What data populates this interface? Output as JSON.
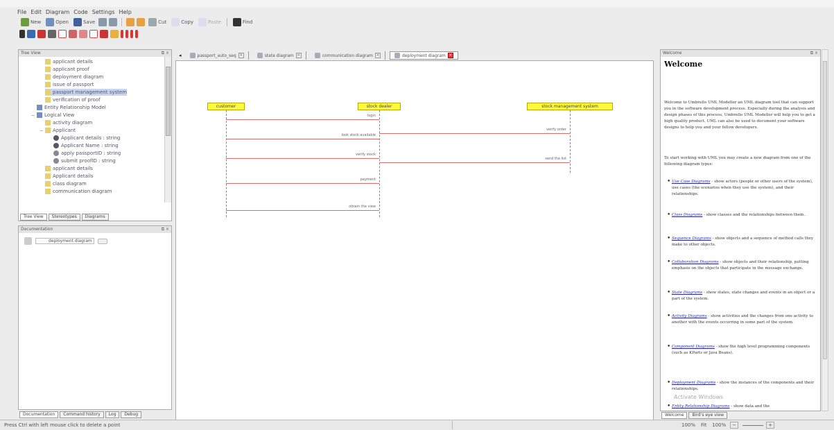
{
  "menu": [
    "File",
    "Edit",
    "Diagram",
    "Code",
    "Settings",
    "Help"
  ],
  "toolbar1": {
    "new": "New",
    "open": "Open",
    "save": "Save",
    "cut": "Cut",
    "copy": "Copy",
    "paste": "Paste",
    "find": "Find"
  },
  "tree_view": {
    "title": "Tree View",
    "items": [
      "applicant details",
      "applicant proof",
      "deployment diagram",
      "issue of passport",
      "passport management system",
      "verification of proof",
      "Entity Relationship Model",
      "Logical View",
      "activity diagram",
      "Applicant",
      "Applicant details : string",
      "Applicant Name : string",
      "apply passportID : string",
      "submit proofID : string",
      "applicant details",
      "Applicant details",
      "class diagram",
      "communication diagram"
    ],
    "tabs": [
      "Tree View",
      "Stereotypes",
      "Diagrams"
    ]
  },
  "documentation": {
    "title": "Documentation",
    "value": "deployment diagram"
  },
  "bottom_tabs": [
    "Documentation",
    "Command history",
    "Log",
    "Debug"
  ],
  "diagram_tabs": [
    {
      "label": "passport_auto_seq",
      "active": false
    },
    {
      "label": "state diagram",
      "active": false
    },
    {
      "label": "communication diagram",
      "active": false
    },
    {
      "label": "deployment diagram",
      "active": true
    }
  ],
  "sequence": {
    "objects": [
      "customer",
      "stock dealer",
      "stock management system"
    ],
    "messages": [
      "login",
      "look stock available",
      "verify stock",
      "payment",
      "obtain the view",
      "verify order",
      "send the list"
    ]
  },
  "welcome": {
    "panel_title": "Welcome",
    "heading": "Welcome",
    "intro": "Welcome to Umbrello UML Modeller an UML diagram tool that can support you in the software development process. Especially during the analysis and design phases of this process, Umbrello UML Modeller will help you to get a high quality product. UML can also be used to document your software designs to help you and your fellow developers.",
    "intro2": "To start working with UML you may create a new diagram from one of the following diagram types:",
    "items": [
      {
        "link": "Use Case Diagrams",
        "text": " - show actors (people or other users of the system), use cases (the scenarios when they use the system), and their relationships."
      },
      {
        "link": "Class Diagrams",
        "text": " - show classes and the relationships between them."
      },
      {
        "link": "Sequence Diagrams",
        "text": " - show objects and a sequence of method calls they make to other objects."
      },
      {
        "link": "Collaboration Diagrams",
        "text": " - show objects and their relationship, putting emphasis on the objects that participate in the message exchange."
      },
      {
        "link": "State Diagrams",
        "text": " - show states, state changes and events in an object or a part of the system."
      },
      {
        "link": "Activity Diagrams",
        "text": " - show activities and the changes from one activity to another with the events occurring in some part of the system."
      },
      {
        "link": "Component Diagrams",
        "text": " - show the high level programming components (such as KParts or Java Beans)."
      },
      {
        "link": "Deployment Diagrams",
        "text": " - show the instances of the components and their relationships."
      },
      {
        "link": "Entity Relationship Diagrams",
        "text": " - show data and the"
      }
    ],
    "tabs": [
      "Welcome",
      "Birdʼs eye view"
    ],
    "watermark": "Activate Windows"
  },
  "status": {
    "text": "Press Ctrl with left mouse click to delete a point",
    "zoom": "100%",
    "fit": "Fit",
    "zoom2": "100%"
  }
}
